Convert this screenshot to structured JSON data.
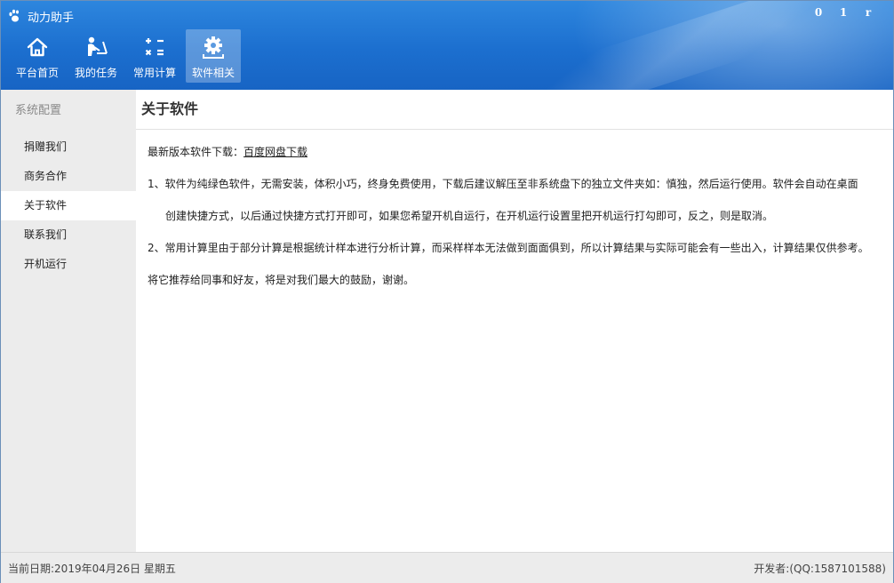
{
  "app": {
    "title": "动力助手"
  },
  "window_controls": {
    "minimize": "0",
    "maximize": "1",
    "close": "r"
  },
  "nav": [
    {
      "label": "平台首页",
      "icon": "home-icon"
    },
    {
      "label": "我的任务",
      "icon": "person-desk-icon"
    },
    {
      "label": "常用计算",
      "icon": "calculator-icon"
    },
    {
      "label": "软件相关",
      "icon": "gear-icon",
      "active": true
    }
  ],
  "sidebar": {
    "header": "系统配置",
    "items": [
      {
        "label": "捐赠我们"
      },
      {
        "label": "商务合作"
      },
      {
        "label": "关于软件",
        "active": true
      },
      {
        "label": "联系我们"
      },
      {
        "label": "开机运行"
      }
    ]
  },
  "main": {
    "title": "关于软件",
    "download_prefix": "最新版本软件下载：",
    "download_link": "百度网盘下载",
    "para1_line1": "1、软件为纯绿色软件，无需安装，体积小巧，终身免费使用，下载后建议解压至非系统盘下的独立文件夹如：慎独，然后运行使用。软件会自动在桌面",
    "para1_line2": "创建快捷方式，以后通过快捷方式打开即可，如果您希望开机自运行，在开机运行设置里把开机运行打勾即可，反之，则是取消。",
    "para2": "2、常用计算里由于部分计算是根据统计样本进行分析计算，而采样样本无法做到面面俱到，所以计算结果与实际可能会有一些出入，计算结果仅供参考。",
    "para3": "将它推荐给同事和好友，将是对我们最大的鼓励，谢谢。"
  },
  "status": {
    "date": "当前日期:2019年04月26日 星期五",
    "developer": "开发者:(QQ:1587101588)"
  },
  "colors": {
    "header": "#1c6fcf",
    "sidebar": "#ececec",
    "active_nav": "#7fb0e8"
  }
}
